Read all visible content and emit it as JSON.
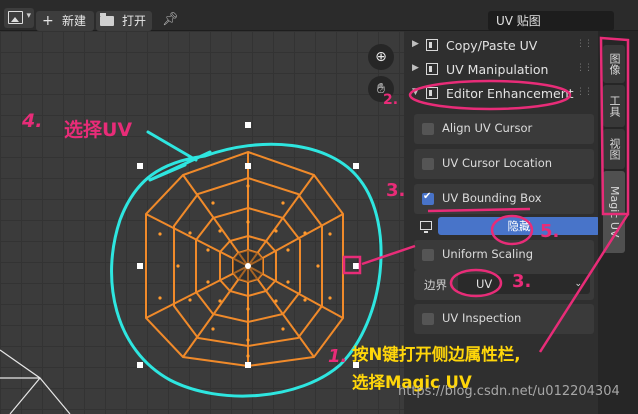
{
  "header": {
    "new_label": "新建",
    "open_label": "打开",
    "image_name": "UV 贴图"
  },
  "panel": {
    "sections": [
      {
        "label": "Copy/Paste UV",
        "arrow": "▶"
      },
      {
        "label": "UV Manipulation",
        "arrow": "▶"
      },
      {
        "label": "Editor Enhancement",
        "arrow": "▼"
      }
    ],
    "options": {
      "align_uv_cursor": "Align UV Cursor",
      "uv_cursor_location": "UV Cursor Location",
      "uv_bounding_box": "UV Bounding Box",
      "hide_button": "隐藏",
      "uniform_scaling": "Uniform Scaling",
      "boundary_label": "边界",
      "boundary_value": "UV",
      "uv_inspection": "UV Inspection"
    }
  },
  "tabs": [
    "图像",
    "工具",
    "视图",
    "Magic UV"
  ],
  "annotations": {
    "step4": "4.",
    "select_uv": "选择UV",
    "step2": "2.",
    "step3a": "3.",
    "step5": "5.",
    "step3b": "3.",
    "step1": "1.",
    "note_line1": "按N键打开侧边属性栏,",
    "note_line2": "选择Magic UV"
  },
  "watermark": "https://blog.csdn.net/u012204304",
  "colors": {
    "annotation_pink": "#e82c78",
    "annotation_cyan": "#2ee6e0",
    "annotation_yellow": "#ffd60a",
    "mesh_orange": "#f08a2a",
    "accent_blue": "#4874c9"
  }
}
